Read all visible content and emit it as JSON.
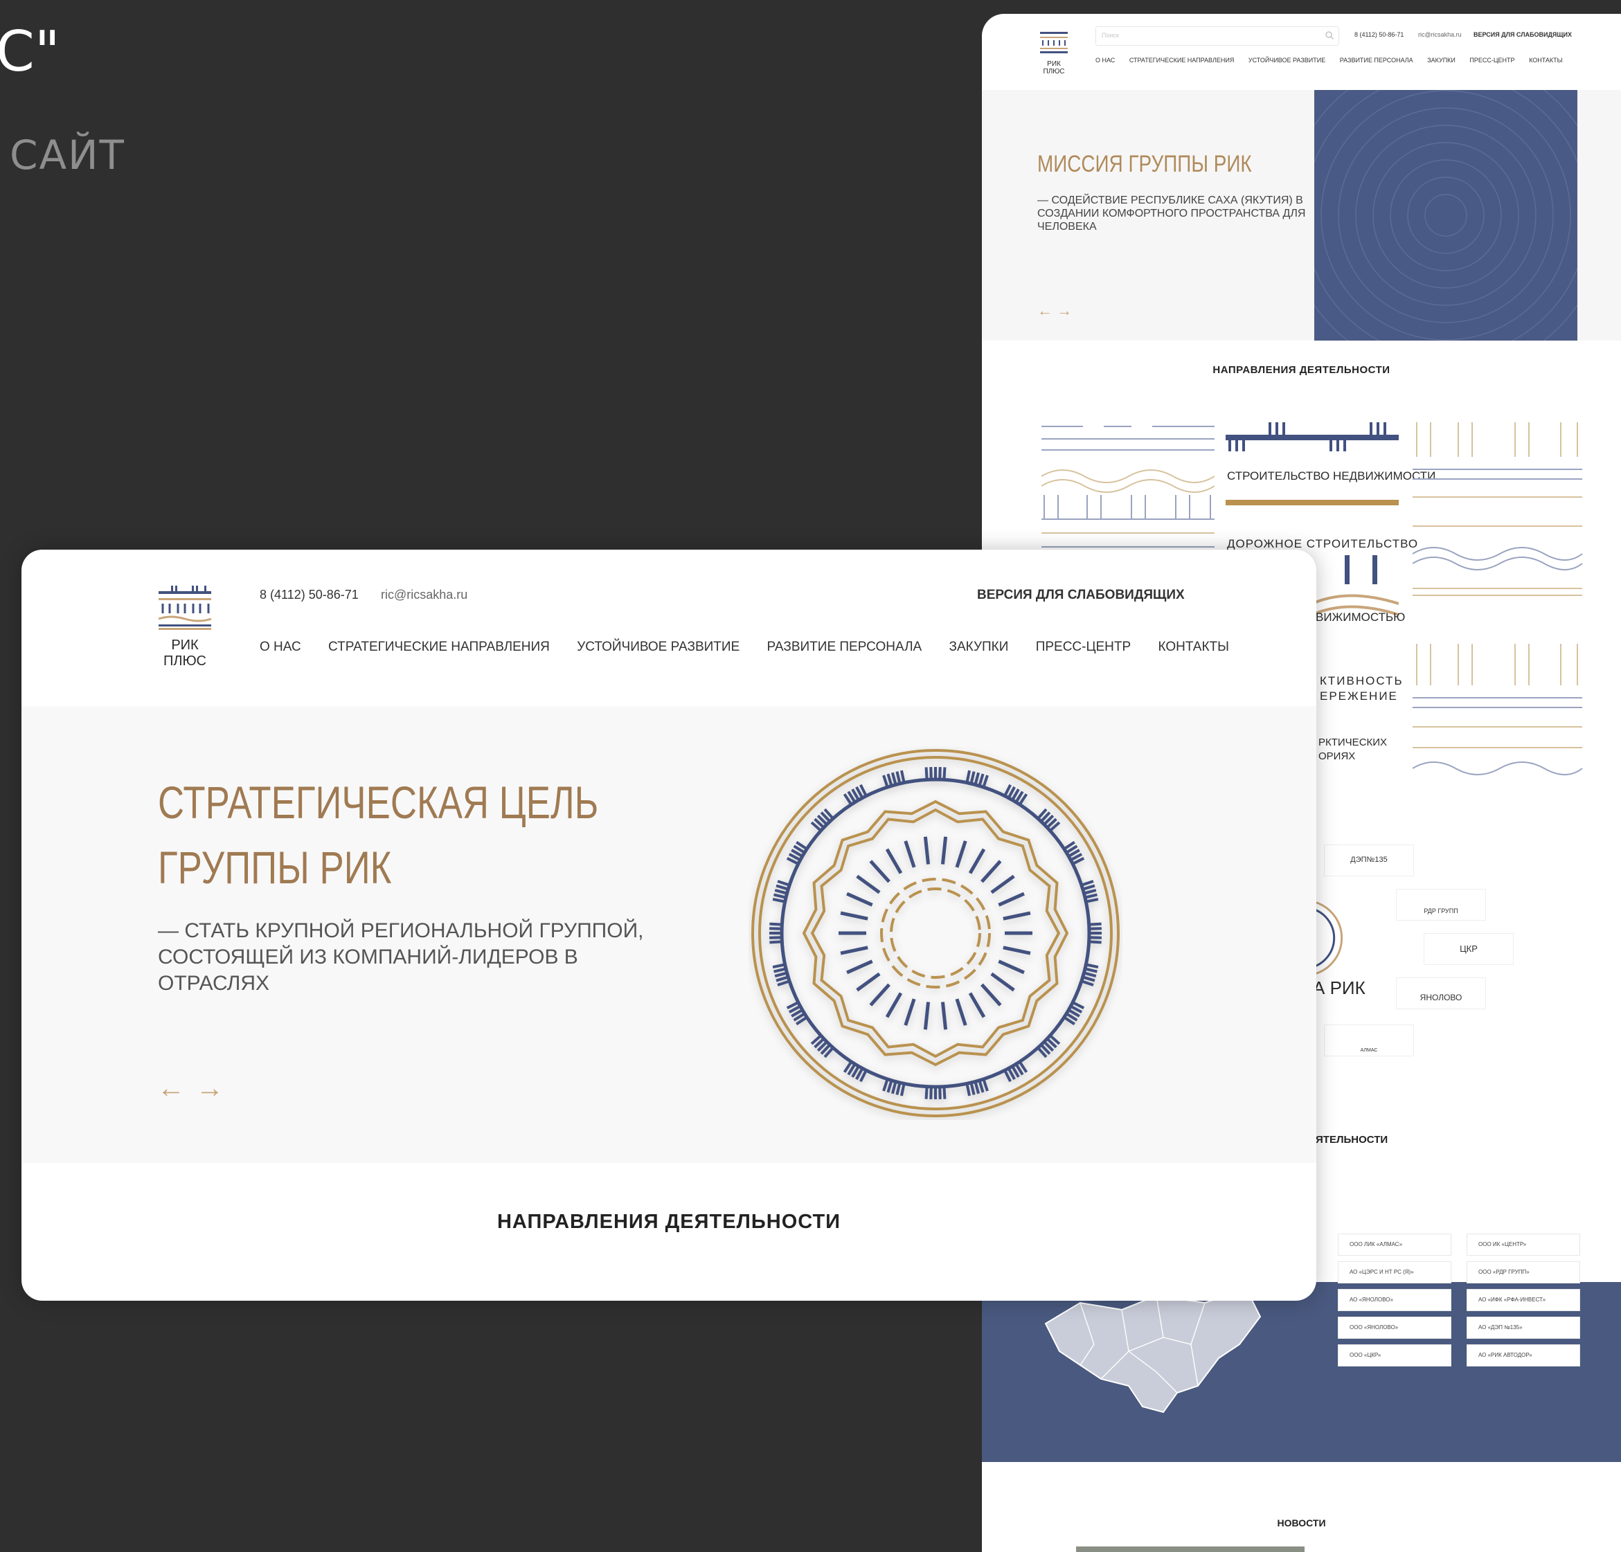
{
  "bg": {
    "partial_title": "С\"",
    "subtitle": "САЙТ"
  },
  "back": {
    "logo_text": "РИК ПЛЮС",
    "search_placeholder": "Поиск",
    "phone": "8 (4112) 50-86-71",
    "email": "ric@ricsakha.ru",
    "vision": "ВЕРСИЯ ДЛЯ СЛАБОВИДЯЩИХ",
    "nav": [
      "О НАС",
      "СТРАТЕГИЧЕСКИЕ НАПРАВЛЕНИЯ",
      "УСТОЙЧИВОЕ РАЗВИТИЕ",
      "РАЗВИТИЕ ПЕРСОНАЛА",
      "ЗАКУПКИ",
      "ПРЕСС-ЦЕНТР",
      "КОНТАКТЫ"
    ],
    "mission_title": "МИССИЯ ГРУППЫ РИК",
    "mission_text": "— СОДЕЙСТВИЕ РЕСПУБЛИКЕ САХА (ЯКУТИЯ) В СОЗДАНИИ КОМФОРТНОГО ПРОСТРАНСТВА ДЛЯ ЧЕЛОВЕКА",
    "arrows": "← →",
    "directions_title": "НАПРАВЛЕНИЯ ДЕЯТЕЛЬНОСТИ",
    "directions": [
      "СТРОИТЕЛЬСТВО НЕДВИЖИМОСТИ",
      "ДОРОЖНОЕ СТРОИТЕЛЬСТВО",
      "ВИЖИМОСТЬЮ",
      "КТИВНОСТЬ",
      "ЕРЕЖЕНИЕ",
      "РКТИЧЕСКИХ",
      "ОРИЯХ"
    ],
    "group_label": "А РИК",
    "logos": [
      "ДЭП№135",
      "РДР ГРУПП",
      "ЦКР",
      "ЯНОЛОВО",
      "АЛМАС"
    ],
    "geo_title": "ЯТЕЛЬНОСТИ",
    "companies_left": [
      "ООО ЛИК «АЛМАС»",
      "АО «ЦЭРС И НТ РС (Я)»",
      "АО «ЯНОЛОВО»",
      "ООО «ЯНОЛОВО»",
      "ООО «ЦКР»"
    ],
    "companies_right": [
      "ООО ИК «ЦЕНТР»",
      "ООО «РДР ГРУПП»",
      "АО «ИФК «РФА-ИНВЕСТ»",
      "АО «ДЭП №135»",
      "АО «РИК АВТОДОР»"
    ],
    "news_title": "НОВОСТИ"
  },
  "front": {
    "logo_text": "РИК ПЛЮС",
    "phone": "8 (4112) 50-86-71",
    "email": "ric@ricsakha.ru",
    "vision": "ВЕРСИЯ ДЛЯ СЛАБОВИДЯЩИХ",
    "nav": [
      "О НАС",
      "СТРАТЕГИЧЕСКИЕ НАПРАВЛЕНИЯ",
      "УСТОЙЧИВОЕ РАЗВИТИЕ",
      "РАЗВИТИЕ ПЕРСОНАЛА",
      "ЗАКУПКИ",
      "ПРЕСС-ЦЕНТР",
      "КОНТАКТЫ"
    ],
    "title_line1": "СТРАТЕГИЧЕСКАЯ ЦЕЛЬ",
    "title_line2": "ГРУППЫ РИК",
    "goal_text": "— СТАТЬ КРУПНОЙ РЕГИОНАЛЬНОЙ ГРУППОЙ, СОСТОЯЩЕЙ ИЗ КОМПАНИЙ-ЛИДЕРОВ В ОТРАСЛЯХ",
    "arrow_prev": "←",
    "arrow_next": "→",
    "directions_title": "НАПРАВЛЕНИЯ ДЕЯТЕЛЬНОСТИ"
  },
  "colors": {
    "gold": "#c9a57a",
    "navy": "#42517f",
    "bg": "#2f2f2f"
  }
}
